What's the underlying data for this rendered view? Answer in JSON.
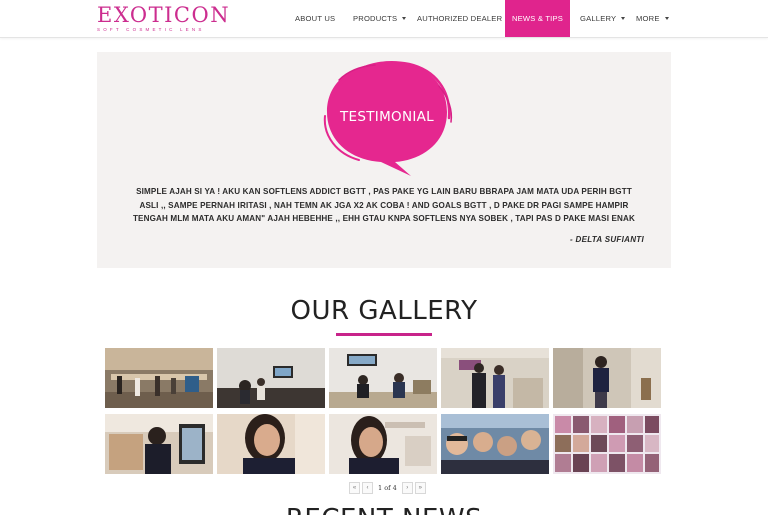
{
  "brand": {
    "name": "EXOTICON",
    "tagline": "SOFT COSMETIC LENS",
    "accent_color": "#e0248d"
  },
  "nav": {
    "items": [
      {
        "label": "ABOUT US",
        "has_dropdown": false,
        "active": false
      },
      {
        "label": "PRODUCTS",
        "has_dropdown": true,
        "active": false
      },
      {
        "label": "AUTHORIZED DEALER",
        "has_dropdown": false,
        "active": false
      },
      {
        "label": "NEWS & TIPS",
        "has_dropdown": false,
        "active": true
      },
      {
        "label": "GALLERY",
        "has_dropdown": true,
        "active": false
      },
      {
        "label": "MORE",
        "has_dropdown": true,
        "active": false
      }
    ]
  },
  "testimonial": {
    "heading": "TESTIMONIAL",
    "quote_lines": [
      "SIMPLE AJAH SI YA ! AKU KAN SOFTLENS ADDICT BGTT , PAS PAKE YG LAIN BARU BBRAPA JAM MATA UDA PERIH BGTT",
      "ASLI ,, SAMPE PERNAH IRITASI , NAH TEMN AK JGA X2 AK COBA ! AND GOALS BGTT , D PAKE DR PAGI SAMPE HAMPIR",
      "TENGAH MLM MATA AKU AMAN\" AJAH HEBEHHE ,, EHH GTAU KNPA SOFTLENS NYA SOBEK , TAPI PAS D PAKE MASI ENAK"
    ],
    "author": "- DELTA SUFIANTI"
  },
  "gallery": {
    "title": "OUR GALLERY",
    "photos": [
      {
        "name": "gallery-photo-event-hall"
      },
      {
        "name": "gallery-photo-presentation"
      },
      {
        "name": "gallery-photo-talkshow"
      },
      {
        "name": "gallery-photo-guests"
      },
      {
        "name": "gallery-photo-model-standing"
      },
      {
        "name": "gallery-photo-phone-selfie"
      },
      {
        "name": "gallery-photo-portrait-smile"
      },
      {
        "name": "gallery-photo-portrait-exoticon"
      },
      {
        "name": "gallery-photo-group-selfie"
      },
      {
        "name": "gallery-photo-collage"
      }
    ],
    "pager": {
      "first": "«",
      "prev": "‹",
      "info": "1 of 4",
      "next": "›",
      "last": "»"
    }
  },
  "news": {
    "title": "RECENT NEWS"
  }
}
